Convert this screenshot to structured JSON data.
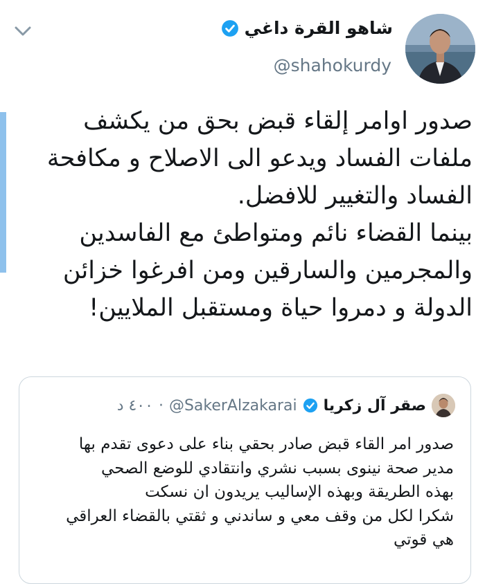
{
  "tweet": {
    "author": {
      "display_name": "شاهو القرة داغي",
      "handle": "@shahokurdy",
      "verified_icon": "verified-badge-icon",
      "avatar_icon": "profile-photo"
    },
    "menu_icon": "chevron-down-icon",
    "body_lines": [
      "صدور اوامر إلقاء قبض بحق من يكشف",
      "ملفات الفساد ويدعو الى الاصلاح و مكافحة",
      "الفساد والتغيير للافضل.",
      "بينما القضاء نائم ومتواطئ مع الفاسدين",
      "والمجرمين والسارقين ومن افرغوا خزائن",
      "الدولة و دمروا حياة ومستقبل الملايين!"
    ]
  },
  "quoted_tweet": {
    "author": {
      "display_name": "صقر آل زكريا",
      "handle": "@SakerAlzakarai",
      "verified_icon": "verified-badge-icon",
      "avatar_icon": "profile-photo"
    },
    "separator": "·",
    "time": "٤٠٠ د",
    "body_lines": [
      "صدور امر القاء قبض صادر بحقي بناء على دعوى تقدم بها",
      "مدير صحة نينوى بسبب نشري وانتقادي للوضع الصحي",
      "بهذه الطريقة وبهذه الإساليب يريدون ان نسكت",
      "شكرا لكل من وقف معي و ساندني و ثقتي بالقضاء العراقي",
      "هي قوتي"
    ]
  },
  "colors": {
    "verified": "#1da1f2",
    "secondary_text": "#657786",
    "border": "#ccd6dd",
    "accent_strip": "#8ec1ec"
  }
}
